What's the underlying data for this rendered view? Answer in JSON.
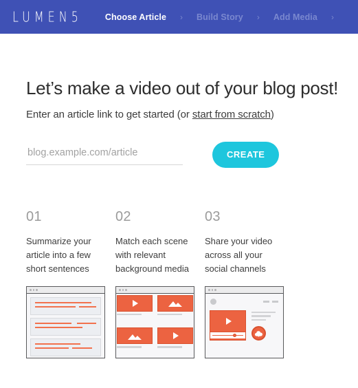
{
  "navbar": {
    "logo": "LUMEN5",
    "separator": "›",
    "steps": [
      {
        "label": "Choose Article",
        "active": true
      },
      {
        "label": "Build Story",
        "active": false
      },
      {
        "label": "Add Media",
        "active": false
      }
    ]
  },
  "hero": {
    "headline": "Let’s make a video out of your blog post!",
    "subhead_before": "Enter an article link to get started (or ",
    "subhead_link": "start from scratch",
    "subhead_after": ")"
  },
  "form": {
    "input_placeholder": "blog.example.com/article",
    "input_value": "",
    "create_label": "CREATE"
  },
  "steps": [
    {
      "number": "01",
      "text": "Summarize your article into a few short sentences"
    },
    {
      "number": "02",
      "text": "Match each scene with relevant background media"
    },
    {
      "number": "03",
      "text": "Share your video across all your social channels"
    }
  ],
  "illustrations": [
    {
      "name": "article-text-blocks",
      "icons": []
    },
    {
      "name": "media-grid",
      "icons": [
        "play-icon",
        "image-icon",
        "image-icon",
        "play-icon"
      ]
    },
    {
      "name": "share-video",
      "icons": [
        "play-icon",
        "cloud-upload-icon"
      ]
    }
  ],
  "colors": {
    "nav_background": "#3f51b5",
    "nav_inactive_text": "#7a88cf",
    "create_button": "#1ec6dd",
    "illustration_orange": "#ec6341",
    "illustration_orange_dark": "#d9512f",
    "text_line_orange": "#f2714d",
    "step_number_grey": "#9b9b9b"
  }
}
